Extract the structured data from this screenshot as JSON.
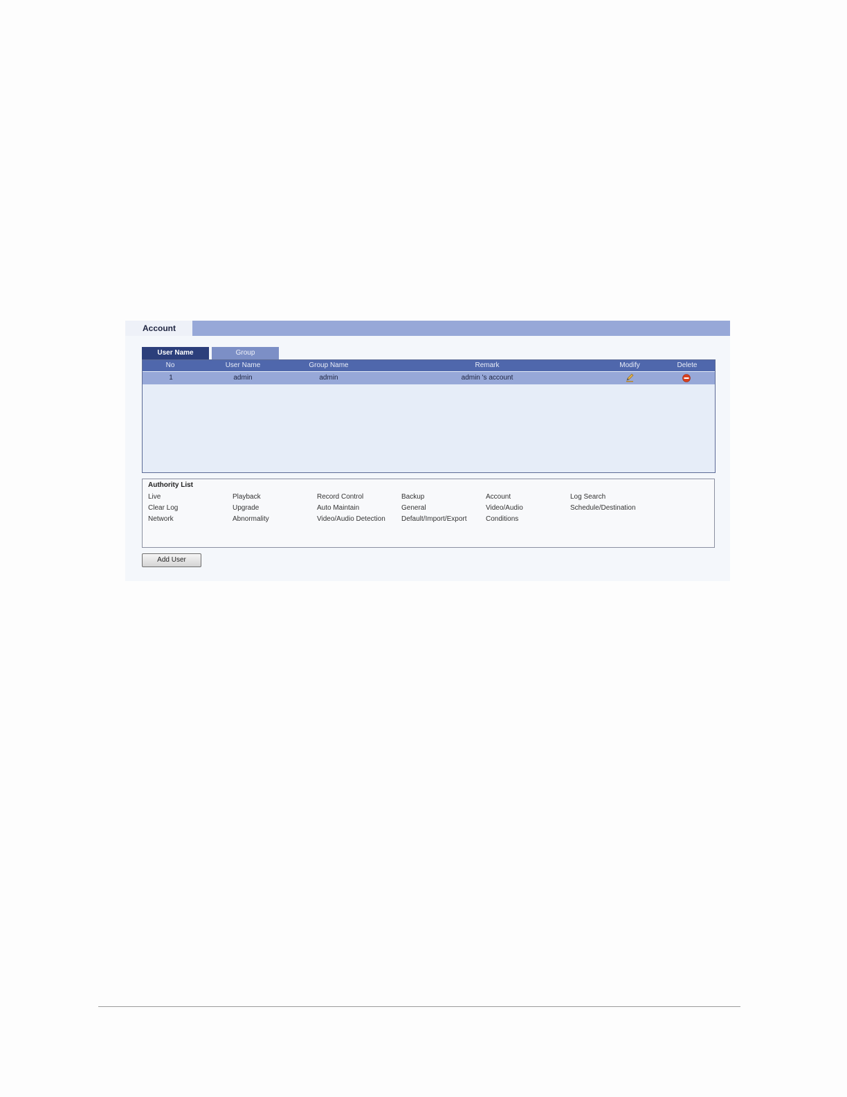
{
  "panel": {
    "title": "Account",
    "tabs": [
      {
        "label": "User Name",
        "active": true
      },
      {
        "label": "Group",
        "active": false
      }
    ],
    "table": {
      "headers": [
        "No",
        "User Name",
        "Group Name",
        "Remark",
        "Modify",
        "Delete"
      ],
      "rows": [
        {
          "no": "1",
          "user_name": "admin",
          "group_name": "admin",
          "remark": "admin 's account",
          "modify_icon": "pencil-icon",
          "delete_icon": "delete-icon"
        }
      ]
    },
    "authority": {
      "title": "Authority List",
      "items": [
        "Live",
        "Playback",
        "Record Control",
        "Backup",
        "Account",
        "Log Search",
        "Clear Log",
        "Upgrade",
        "Auto Maintain",
        "General",
        "Video/Audio",
        "Schedule/Destination",
        "Network",
        "Abnormality",
        "Video/Audio Detection",
        "Default/Import/Export",
        "Conditions"
      ]
    },
    "add_user_label": "Add User"
  },
  "colors": {
    "header_bar": "#97a8d8",
    "tab_active": "#2c3f7b",
    "tab_inactive": "#7c8fc6",
    "table_head": "#4f67ac",
    "selected_row": "#97a8d8",
    "delete_red": "#d9401e"
  }
}
